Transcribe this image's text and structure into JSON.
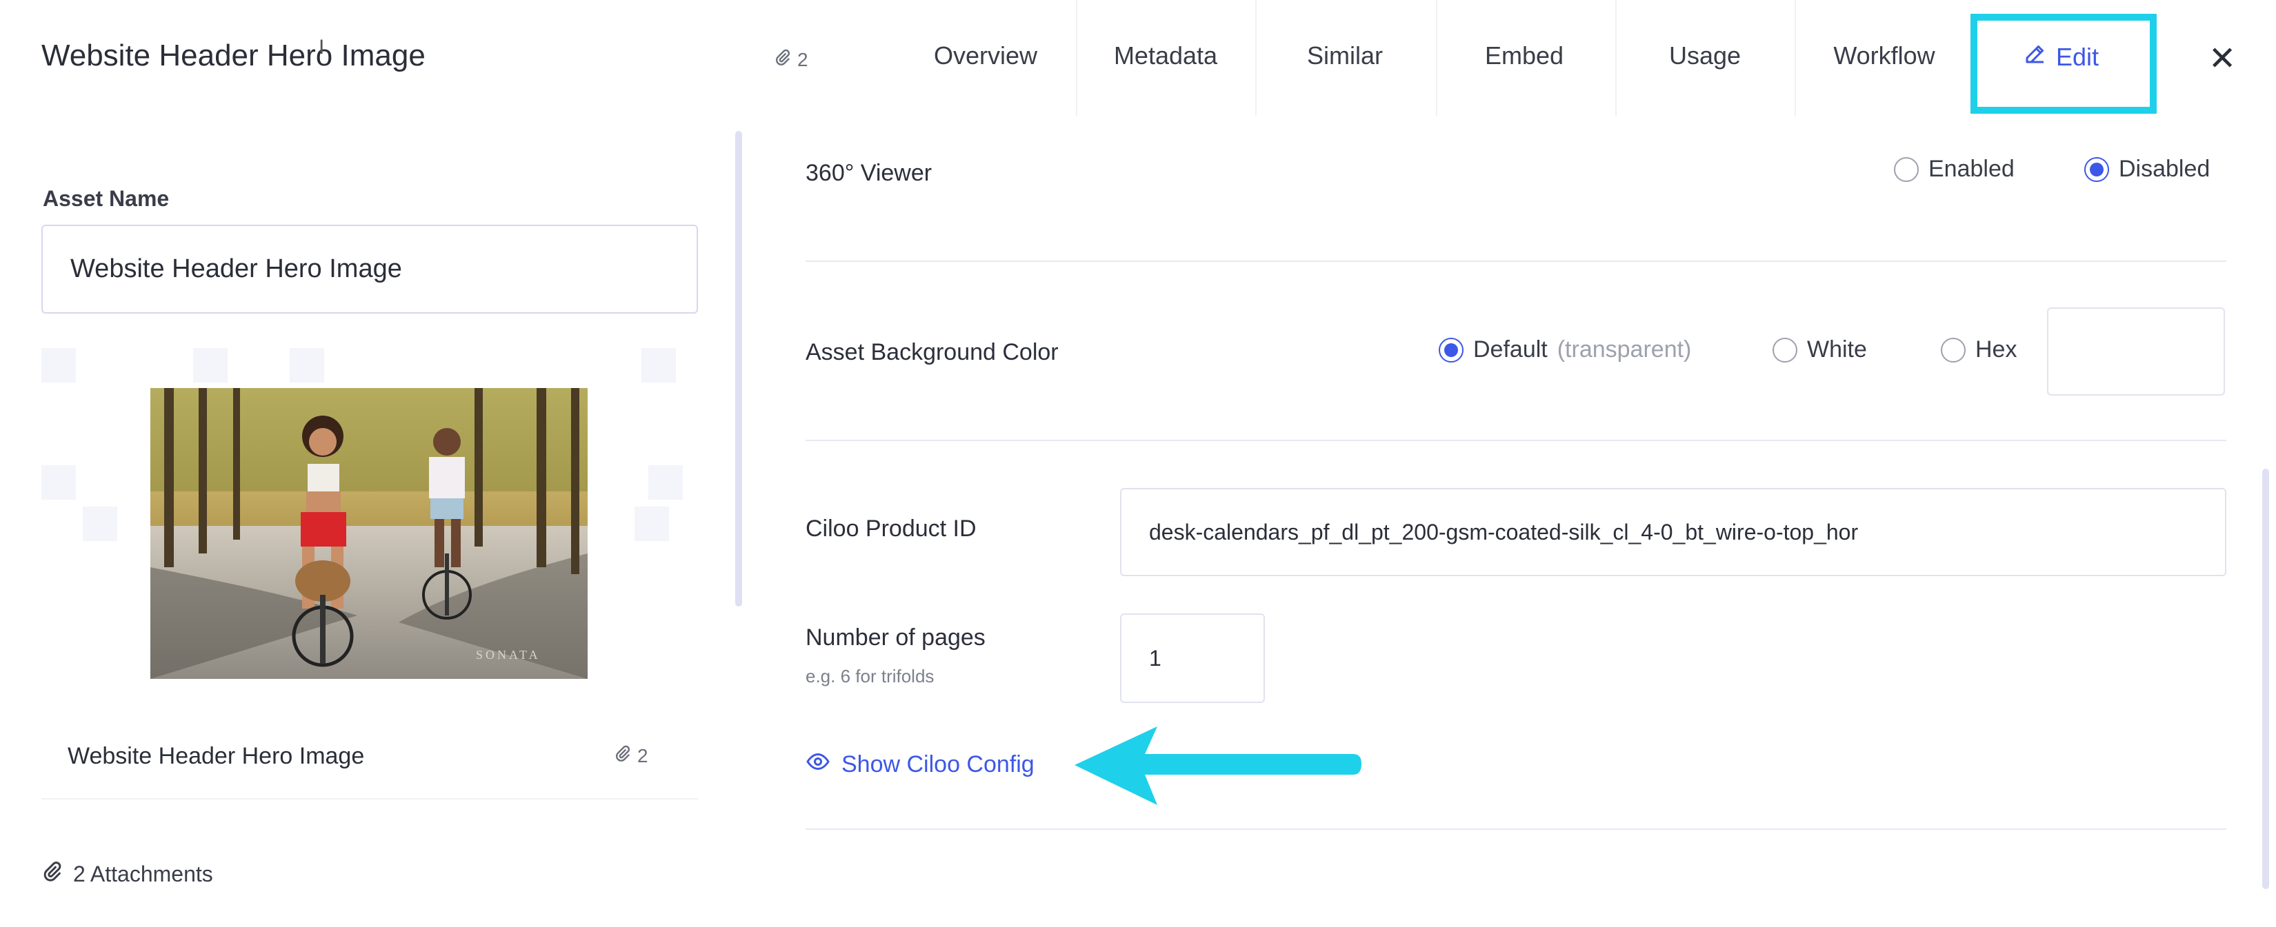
{
  "header": {
    "title": "Website Header Hero Image",
    "attachment_count": "2",
    "tabs": [
      {
        "label": "Overview"
      },
      {
        "label": "Metadata"
      },
      {
        "label": "Similar"
      },
      {
        "label": "Embed"
      },
      {
        "label": "Usage"
      },
      {
        "label": "Workflow"
      }
    ],
    "edit_label": "Edit",
    "close_glyph": "✕",
    "highlight_color": "#1fd0ea"
  },
  "left_panel": {
    "asset_name_label": "Asset Name",
    "asset_name_value": "Website Header Hero Image",
    "image_caption": "SONATA",
    "thumb_name": "Website Header Hero Image",
    "thumb_attachment_count": "2",
    "attachments_text": "2 Attachments"
  },
  "form": {
    "viewer_label": "360° Viewer",
    "viewer_options": [
      "Enabled",
      "Disabled"
    ],
    "viewer_selected": "Disabled",
    "bg_color_label": "Asset Background Color",
    "bg_options": {
      "default": "Default",
      "default_note": "(transparent)",
      "white": "White",
      "hex": "Hex"
    },
    "bg_selected": "Default",
    "hex_value": "",
    "product_id_label": "Ciloo Product ID",
    "product_id_value": "desk-calendars_pf_dl_pt_200-gsm-coated-silk_cl_4-0_bt_wire-o-top_hor",
    "pages_label": "Number of pages",
    "pages_hint": "e.g. 6 for trifolds",
    "pages_value": "1",
    "show_config_label": "Show Ciloo Config",
    "accent_color": "#3d57e6"
  }
}
